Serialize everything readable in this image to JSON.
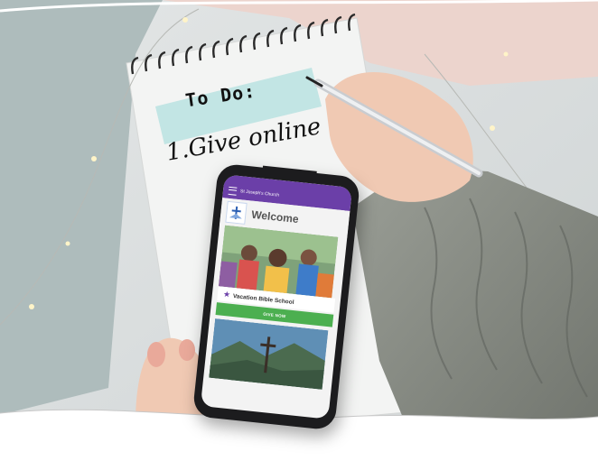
{
  "notebook": {
    "heading": "To Do:",
    "item": "1.Give online"
  },
  "phone_app": {
    "church_name": "St Joseph's Church",
    "welcome_title": "Welcome",
    "card_title": "Vacation Bible School",
    "give_button_label": "GIVE NOW"
  },
  "icons": {
    "menu": "menu-icon",
    "star": "star-icon",
    "logo": "church-logo-icon",
    "pen": "pen-icon"
  },
  "colors": {
    "app_header": "#6b3fa8",
    "give_button": "#4caf50",
    "tape_highlight": "#bfe4e3",
    "sweater": "#8c9088"
  }
}
